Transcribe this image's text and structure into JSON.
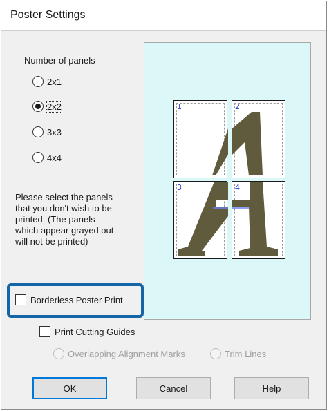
{
  "dialog": {
    "title": "Poster Settings"
  },
  "panels_group": {
    "label": "Number of panels",
    "options": [
      {
        "label": "2x1",
        "checked": false
      },
      {
        "label": "2x2",
        "checked": true
      },
      {
        "label": "3x3",
        "checked": false
      },
      {
        "label": "4x4",
        "checked": false
      }
    ]
  },
  "instructions": "Please select the panels\nthat you don't wish to be\nprinted. (The panels\nwhich appear grayed out\nwill not be printed)",
  "preview": {
    "panels": [
      "1",
      "2",
      "3",
      "4"
    ],
    "colors": {
      "background": "#dcf7f7",
      "letter": "#5f5b3c",
      "number": "#1f3fd0"
    }
  },
  "options": {
    "borderless_label": "Borderless Poster Print",
    "borderless_checked": false,
    "cutting_guides_label": "Print Cutting Guides",
    "cutting_guides_checked": false,
    "overlap_label": "Overlapping Alignment Marks",
    "trim_label": "Trim Lines"
  },
  "buttons": {
    "ok": "OK",
    "cancel": "Cancel",
    "help": "Help"
  },
  "accent": "#1466a8"
}
